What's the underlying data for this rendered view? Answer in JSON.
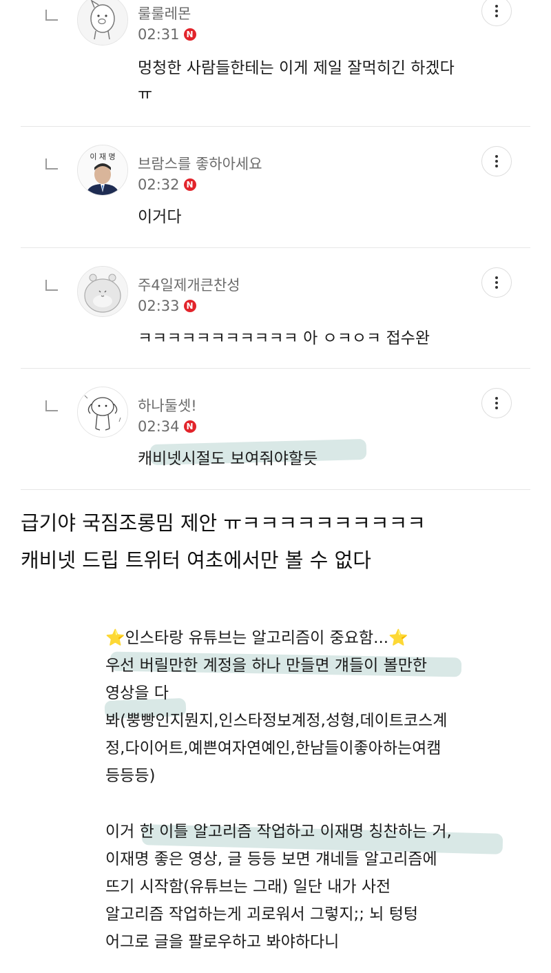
{
  "comments": [
    {
      "nick": "룰룰레몬",
      "time": "02:31",
      "badge": "N",
      "text_lines": [
        "멍청한 사람들한테는 이게 제일 잘먹히긴 하겠다",
        "ㅠ"
      ],
      "avatar": "pig-character"
    },
    {
      "nick": "브람스를 좋하아세요",
      "time": "02:32",
      "badge": "N",
      "text_lines": [
        "이거다"
      ],
      "avatar": "portrait-with-nameplate",
      "avatar_text": "이 재 명"
    },
    {
      "nick": "주4일제개큰찬성",
      "time": "02:33",
      "badge": "N",
      "text_lines": [
        "ㅋㅋㅋㅋㅋㅋㅋㅋㅋㅋㅋ 아 ㅇㅋㅇㅋ 접수완"
      ],
      "avatar": "hamster-character"
    },
    {
      "nick": "하나둘셋!",
      "time": "02:34",
      "badge": "N",
      "text_lines": [
        "캐비넷시절도 보여줘야할듯"
      ],
      "avatar": "puppy-doodle"
    }
  ],
  "post": {
    "lines": [
      "급기야 국짐조롱밈 제안 ㅠㅋㅋㅋㅋㅋㅋㅋㅋㅋㅋ",
      "캐비넷 드립 트위터 여초에서만 볼 수 없다"
    ]
  },
  "quote": {
    "para1": [
      "⭐인스타랑 유튜브는 알고리즘이 중요함...⭐",
      "우선 버릴만한 계정을 하나 만들면 걔들이 볼만한",
      "영상을 다",
      "봐(뿡빵인지뭔지,인스타정보계정,성형,데이트코스계",
      "정,다이어트,예쁜여자연예인,한남들이좋아하는여캠",
      "등등등)"
    ],
    "para2": [
      "이거 한 이틀 알고리즘 작업하고 이재명 칭찬하는 거,",
      "이재명 좋은 영상, 글 등등 보면 걔네들 알고리즘에",
      "뜨기 시작함(유튜브는 그래) 일단 내가 사전",
      "알고리즘 작업하는게 괴로워서 그렇지;; 뇌 텅텅",
      "어그로 글을 팔로우하고 봐야하다니"
    ]
  },
  "icons": {
    "more": "more-vertical-icon",
    "reply": "reply-arrow-icon",
    "badge": "new-badge-icon"
  },
  "colors": {
    "badge": "#e2242b",
    "highlight": "#aacdc8",
    "meta": "#6b6b6b"
  }
}
